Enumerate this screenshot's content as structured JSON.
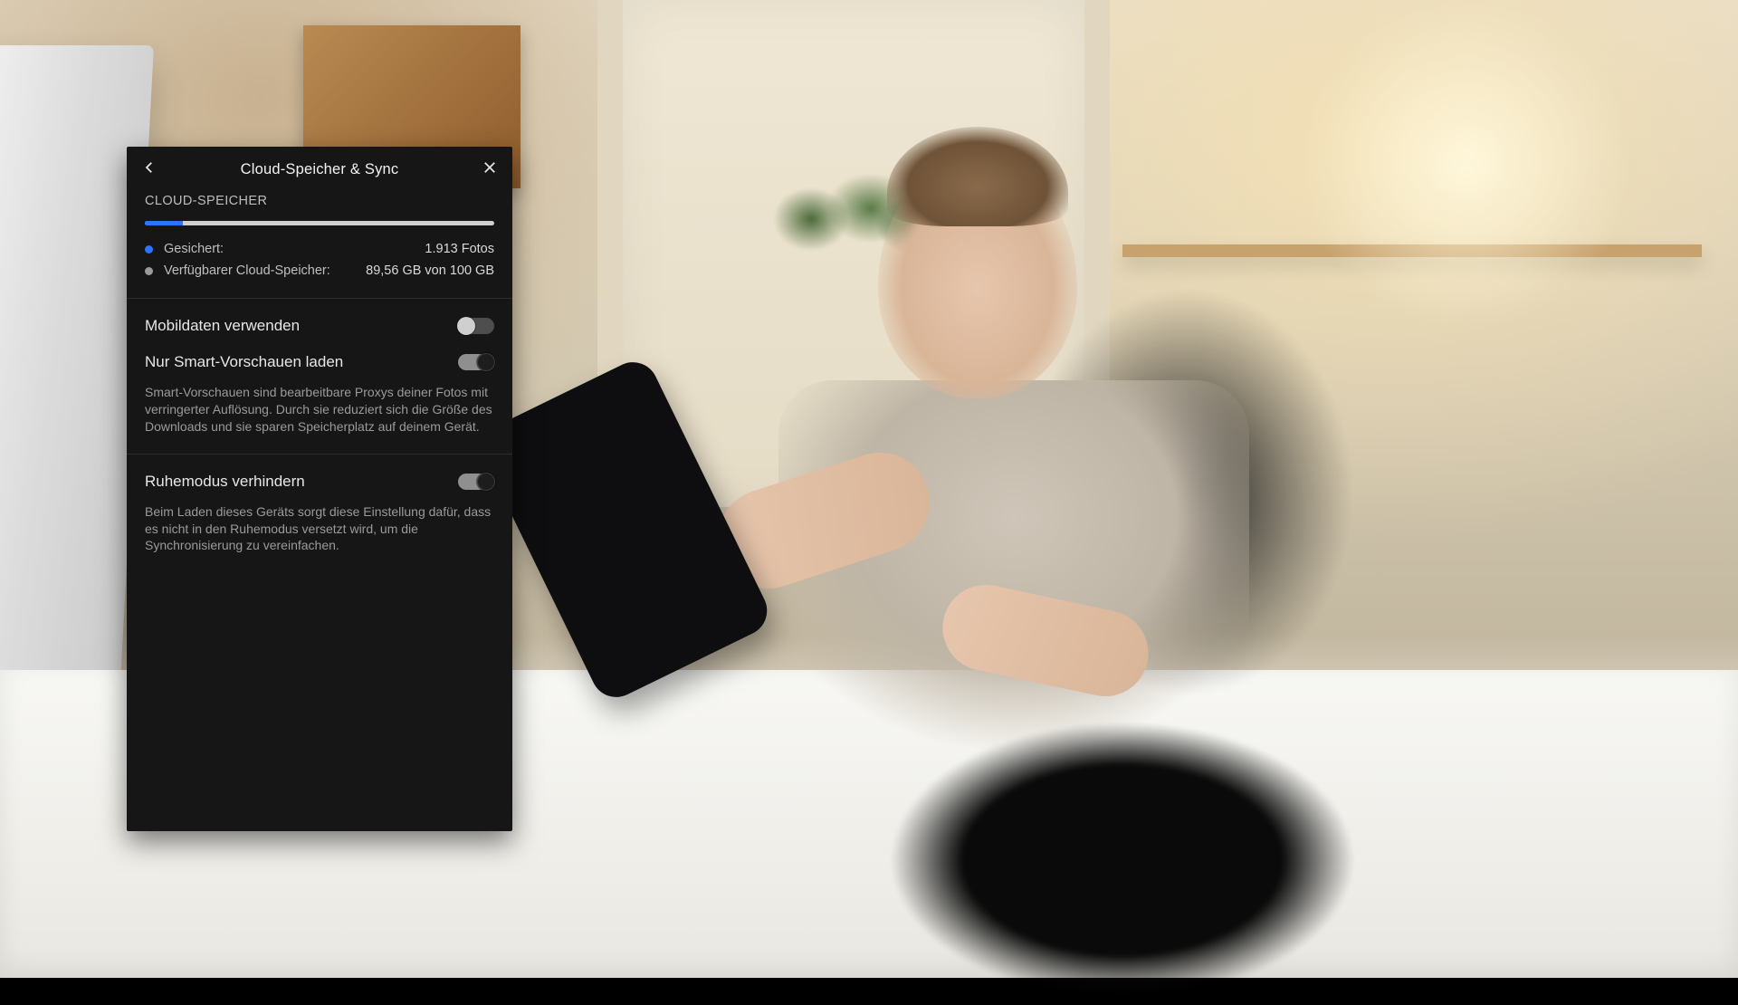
{
  "panel": {
    "title": "Cloud-Speicher & Sync",
    "section_label": "CLOUD-SPEICHER",
    "storage": {
      "used_pct": 11,
      "backed_up": {
        "label": "Gesichert:",
        "value": "1.913 Fotos"
      },
      "available": {
        "label": "Verfügbarer Cloud-Speicher:",
        "value": "89,56 GB von 100 GB"
      }
    },
    "settings": {
      "mobile_data": {
        "title": "Mobildaten verwenden",
        "on": false
      },
      "smart_previews": {
        "title": "Nur Smart-Vorschauen laden",
        "on": true,
        "description": "Smart-Vorschauen sind bearbeitbare Proxys deiner Fotos mit verringerter Auflösung. Durch sie reduziert sich die Größe des Downloads und sie sparen Speicherplatz auf deinem Gerät."
      },
      "prevent_sleep": {
        "title": "Ruhemodus verhindern",
        "on": true,
        "description": "Beim Laden dieses Geräts sorgt diese Einstellung dafür, dass es nicht in den Ruhemodus versetzt wird, um die Synchronisierung zu vereinfachen."
      }
    }
  },
  "colors": {
    "accent_blue": "#2b74ff",
    "panel_bg": "#161616"
  }
}
